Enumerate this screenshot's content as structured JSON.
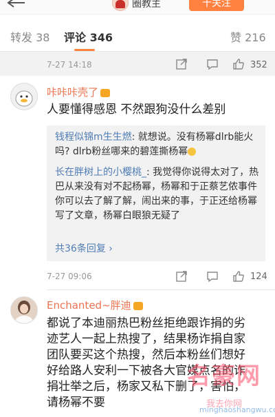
{
  "header": {
    "title": "圈教主",
    "follow_label": "十关注"
  },
  "tabs": {
    "repost": "转发 38",
    "comment": "评论 346",
    "like": "赞 216"
  },
  "post_info": {
    "time": "7-27 14:18",
    "like_count": "352"
  },
  "comments": [
    {
      "username": "咔咔咔壳了",
      "text": "人要懂得感恩 不然跟狗没什么差别",
      "replies": [
        {
          "username": "钱程似锦m生生燃",
          "text": ": 就想说。没有杨幂dlrb能火吗? dlrb粉丝哪来的碧莲撕杨幂"
        },
        {
          "username": "长在胖树上的小樱桃_",
          "text": ": 我觉得你说得太对了，热巴从来没有对不起杨幂，杨幂和于正蔡艺侬事件你可以去了解了解，闹出来的事，于正还给杨幂写了文章，杨幂白眼狼无疑了"
        }
      ],
      "more_replies": "共36条回复 ›",
      "time": "7-27 09:06",
      "like_count": "124"
    },
    {
      "username": "Enchanted~胖迪",
      "text": "都说了本迪丽热巴粉丝拒绝跟诈捐的劣迹艺人一起上热搜了，结果杨诈捐自家团队要买这个热搜，然后本粉丝们想好好给路人安利一下被各大官媒点名的诈捐壮举之后，杨家又私下删了，害怕，请杨幂不要"
    }
  ],
  "watermark": {
    "logo": "名豪网",
    "site": "我去你网",
    "url": "minghaoshangwu.com"
  },
  "colors": {
    "accent": "#ff8140",
    "username": "#eb7350",
    "link": "#4f7cb5"
  }
}
